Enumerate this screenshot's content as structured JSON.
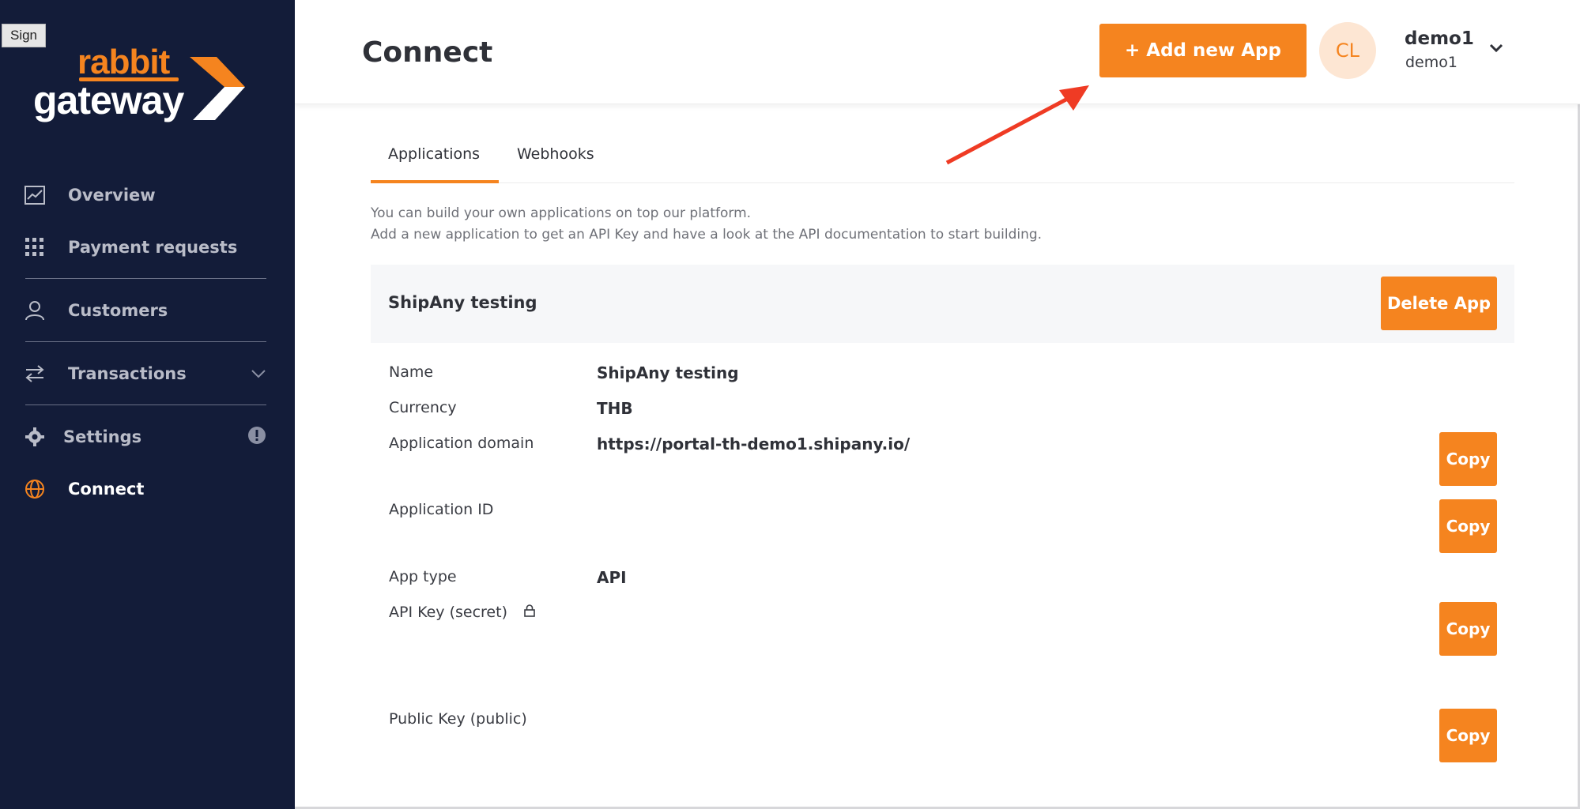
{
  "sign_badge": "Sign",
  "brand": {
    "word1": "rabbit",
    "word2": "gateway",
    "accent": "#f5841f",
    "sidebar_bg": "#131c39"
  },
  "sidebar": {
    "items": [
      {
        "label": "Overview",
        "icon": "chart-line-icon"
      },
      {
        "label": "Payment requests",
        "icon": "grid-icon"
      },
      {
        "label": "Customers",
        "icon": "user-icon"
      },
      {
        "label": "Transactions",
        "icon": "swap-arrows-icon"
      },
      {
        "label": "Settings",
        "icon": "gear-icon"
      },
      {
        "label": "Connect",
        "icon": "globe-icon",
        "active": true
      }
    ]
  },
  "header": {
    "title": "Connect",
    "add_button": "+ Add new App",
    "avatar_initials": "CL",
    "user_name": "demo1",
    "user_sub": "demo1"
  },
  "tabs": [
    {
      "label": "Applications",
      "active": true
    },
    {
      "label": "Webhooks"
    }
  ],
  "description": {
    "line1": "You can build your own applications on top our platform.",
    "line2": "Add a new application to get an API Key and have a look at the API documentation to start building."
  },
  "app": {
    "title": "ShipAny testing",
    "delete_button": "Delete App",
    "fields": {
      "name_label": "Name",
      "name_value": "ShipAny testing",
      "currency_label": "Currency",
      "currency_value": "THB",
      "domain_label": "Application domain",
      "domain_value": "https://portal-th-demo1.shipany.io/",
      "app_id_label": "Application ID",
      "app_type_label": "App type",
      "app_type_value": "API",
      "api_key_label": "API Key (secret)",
      "public_key_label": "Public Key (public)"
    },
    "copy_label": "Copy"
  }
}
